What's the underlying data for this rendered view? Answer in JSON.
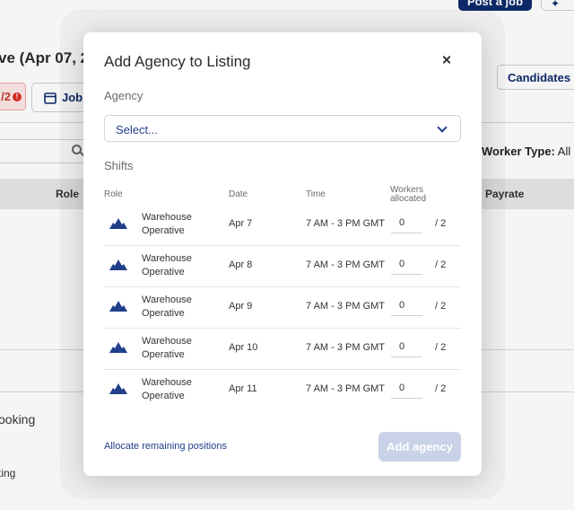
{
  "background": {
    "post_job_label": "Post a job",
    "sparkle_label": "✦",
    "title": "ve (Apr 07, 20",
    "badge_text": "/2",
    "badge_alert": "!",
    "job_button_label": "Job",
    "candidates_label": "Candidates (",
    "worker_type_label": "Worker Type:",
    "worker_type_value": "All",
    "table_role_header": "Role",
    "table_payrate_header": "Payrate",
    "booking_text": "ooking",
    "listing_text": "ting"
  },
  "modal": {
    "title": "Add Agency to Listing",
    "agency_label": "Agency",
    "agency_select_placeholder": "Select...",
    "shifts_label": "Shifts",
    "columns": {
      "role": "Role",
      "date": "Date",
      "time": "Time",
      "workers_line1": "Workers",
      "workers_line2": "allocated"
    },
    "shifts": [
      {
        "role_line1": "Warehouse",
        "role_line2": "Operative",
        "date": "Apr 7",
        "time": "7 AM - 3 PM GMT",
        "allocated": "0",
        "of_total": "/ 2"
      },
      {
        "role_line1": "Warehouse",
        "role_line2": "Operative",
        "date": "Apr 8",
        "time": "7 AM - 3 PM GMT",
        "allocated": "0",
        "of_total": "/ 2"
      },
      {
        "role_line1": "Warehouse",
        "role_line2": "Operative",
        "date": "Apr 9",
        "time": "7 AM - 3 PM GMT",
        "allocated": "0",
        "of_total": "/ 2"
      },
      {
        "role_line1": "Warehouse",
        "role_line2": "Operative",
        "date": "Apr 10",
        "time": "7 AM - 3 PM GMT",
        "allocated": "0",
        "of_total": "/ 2"
      },
      {
        "role_line1": "Warehouse",
        "role_line2": "Operative",
        "date": "Apr 11",
        "time": "7 AM - 3 PM GMT",
        "allocated": "0",
        "of_total": "/ 2"
      }
    ],
    "allocate_link": "Allocate remaining positions",
    "add_button": "Add agency"
  },
  "colors": {
    "brand": "#0d2a6b",
    "link": "#1f3f8a",
    "disabled_button": "#c9d2e6",
    "alert": "#d93025"
  },
  "icons": {
    "role_icon": "hard-hat-icon",
    "close": "close-icon",
    "dropdown": "chevron-down-icon"
  }
}
